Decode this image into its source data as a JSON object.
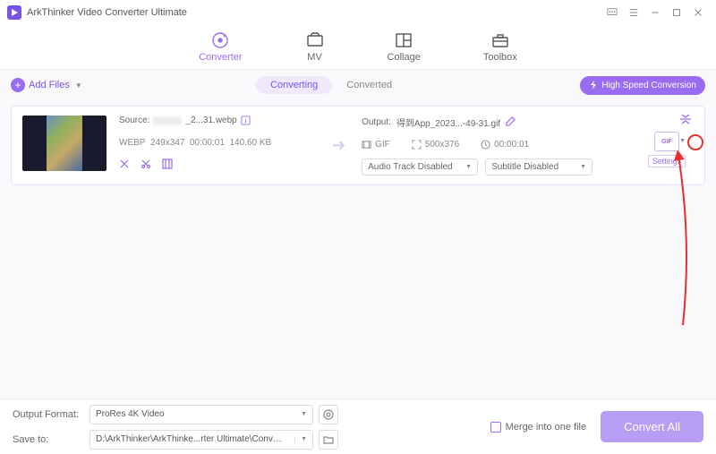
{
  "app": {
    "title": "ArkThinker Video Converter Ultimate"
  },
  "tabs": {
    "converter": "Converter",
    "mv": "MV",
    "collage": "Collage",
    "toolbox": "Toolbox"
  },
  "toolbar": {
    "add_files": "Add Files",
    "sub_converting": "Converting",
    "sub_converted": "Converted",
    "speed_btn": "High Speed Conversion"
  },
  "item": {
    "source_label": "Source:",
    "source_name": "_2...31.webp",
    "src_format": "WEBP",
    "src_res": "249x347",
    "src_dur": "00:00:01",
    "src_size": "140.60 KB",
    "output_label": "Output:",
    "output_name": "得到App_2023...-49-31.gif",
    "out_format": "GIF",
    "out_res": "500x376",
    "out_dur": "00:00:01",
    "audio_select": "Audio Track Disabled",
    "subtitle_select": "Subtitle Disabled",
    "format_badge": "GIF",
    "settings_label": "Settings"
  },
  "footer": {
    "output_format_label": "Output Format:",
    "output_format_value": "ProRes 4K Video",
    "save_to_label": "Save to:",
    "save_to_value": "D:\\ArkThinker\\ArkThinke...rter Ultimate\\Converted",
    "merge_label": "Merge into one file",
    "convert_btn": "Convert All"
  }
}
